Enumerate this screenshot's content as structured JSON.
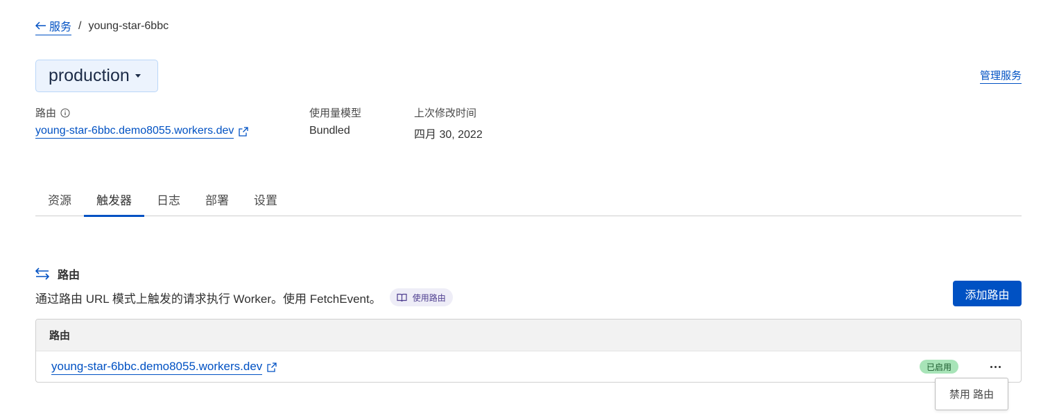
{
  "breadcrumb": {
    "back_label": "服务",
    "separator": "/",
    "current": "young-star-6bbc"
  },
  "environment": {
    "selected": "production"
  },
  "header": {
    "manage_label": "管理服务"
  },
  "meta": {
    "route_label": "路由",
    "route_value": "young-star-6bbc.demo8055.workers.dev",
    "usage_label": "使用量模型",
    "usage_value": "Bundled",
    "modified_label": "上次修改时间",
    "modified_value": "四月 30, 2022"
  },
  "tabs": [
    {
      "label": "资源",
      "active": false
    },
    {
      "label": "触发器",
      "active": true
    },
    {
      "label": "日志",
      "active": false
    },
    {
      "label": "部署",
      "active": false
    },
    {
      "label": "设置",
      "active": false
    }
  ],
  "routes_section": {
    "title": "路由",
    "description": "通过路由 URL 模式上触发的请求执行 Worker。使用 FetchEvent。",
    "docs_chip": "使用路由",
    "add_button": "添加路由",
    "table": {
      "header": "路由",
      "rows": [
        {
          "route": "young-star-6bbc.demo8055.workers.dev",
          "status": "已启用"
        }
      ]
    },
    "row_menu": {
      "disable_label": "禁用 路由"
    }
  },
  "colors": {
    "accent": "#0051c3",
    "enabled_badge": "#a8e4b8",
    "env_bg": "#ecf3fd"
  }
}
